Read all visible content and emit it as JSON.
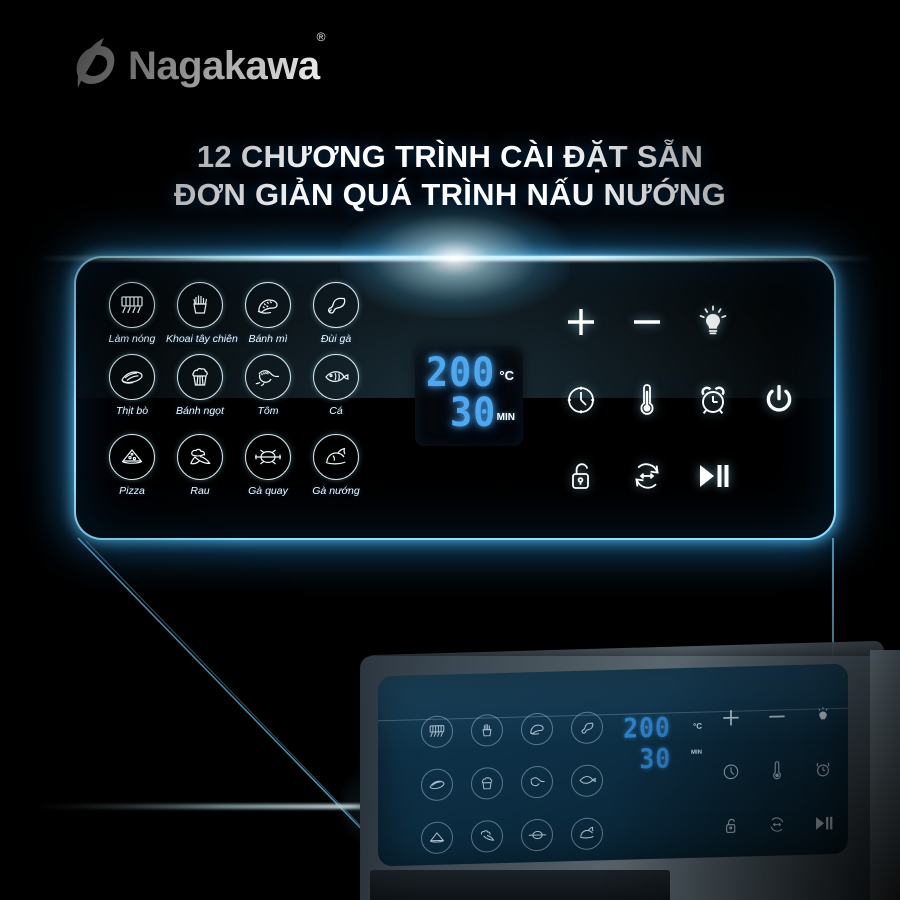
{
  "brand": {
    "name": "Nagakawa",
    "registered_mark": "®",
    "logo_icon": "nagakawa-swoosh-mark"
  },
  "headline": {
    "line1": "12 CHƯƠNG TRÌNH CÀI ĐẶT SẴN",
    "line2": "ĐƠN GIẢN QUÁ TRÌNH NẤU NƯỚNG"
  },
  "colors": {
    "background_top": "#000000",
    "background_mid": "#0a4d73",
    "panel_fill": "#0f6396",
    "panel_border_glow": "#96e6ff",
    "led_digit": "#4ea8f0",
    "led_background": "#05080c",
    "text_white": "#ffffff",
    "power_button_product": "#c0394f"
  },
  "panel": {
    "programs": [
      [
        {
          "label": "Làm nóng",
          "icon": "preheat-coils-icon"
        },
        {
          "label": "Khoai tây chiên",
          "icon": "french-fries-icon"
        },
        {
          "label": "Bánh mì",
          "icon": "bread-loaf-icon"
        },
        {
          "label": "Đùi gà",
          "icon": "chicken-drumstick-icon"
        }
      ],
      [
        {
          "label": "Thịt bò",
          "icon": "beef-steak-icon"
        },
        {
          "label": "Bánh ngọt",
          "icon": "cupcake-icon"
        },
        {
          "label": "Tôm",
          "icon": "shrimp-icon"
        },
        {
          "label": "Cá",
          "icon": "fish-icon"
        }
      ],
      [
        {
          "label": "Pizza",
          "icon": "pizza-slice-icon"
        },
        {
          "label": "Rau",
          "icon": "vegetables-icon"
        },
        {
          "label": "Gà quay",
          "icon": "rotisserie-chicken-icon"
        },
        {
          "label": "Gà nướng",
          "icon": "roast-chicken-icon"
        }
      ]
    ],
    "display": {
      "temperature_value": "200",
      "temperature_unit": "°C",
      "time_value": "30",
      "time_unit": "MIN"
    },
    "controls": [
      [
        {
          "name": "increase",
          "icon": "plus-icon"
        },
        {
          "name": "decrease",
          "icon": "minus-icon"
        },
        {
          "name": "light",
          "icon": "lightbulb-icon"
        }
      ],
      [
        {
          "name": "timer",
          "icon": "clock-icon"
        },
        {
          "name": "temperature",
          "icon": "thermometer-icon"
        },
        {
          "name": "alarm",
          "icon": "alarm-clock-icon"
        },
        {
          "name": "power",
          "icon": "power-icon"
        }
      ],
      [
        {
          "name": "child-lock",
          "icon": "padlock-icon"
        },
        {
          "name": "rotisserie",
          "icon": "rotate-arrows-icon"
        },
        {
          "name": "start-pause",
          "icon": "play-pause-icon"
        }
      ]
    ]
  },
  "product": {
    "display": {
      "temperature_value": "200",
      "temperature_unit": "°C",
      "time_value": "30",
      "time_unit": "MIN"
    },
    "description": "air-fryer-oven-control-panel"
  }
}
